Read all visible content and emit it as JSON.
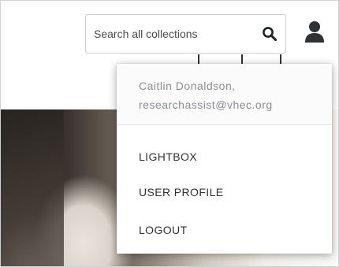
{
  "search": {
    "placeholder": "Search all collections",
    "value": ""
  },
  "icons": {
    "search": "search-icon",
    "user": "user-icon"
  },
  "user_menu": {
    "name_line": "Caitlin Donaldson,",
    "email": "researchassist@vhec.org",
    "items": [
      {
        "label": "LIGHTBOX"
      },
      {
        "label": "USER PROFILE"
      },
      {
        "label": "LOGOUT"
      }
    ]
  },
  "colors": {
    "text_dark": "#2e3134",
    "text_muted": "#8a8f93",
    "border": "#c8cfd3",
    "background": "#ffffff"
  }
}
